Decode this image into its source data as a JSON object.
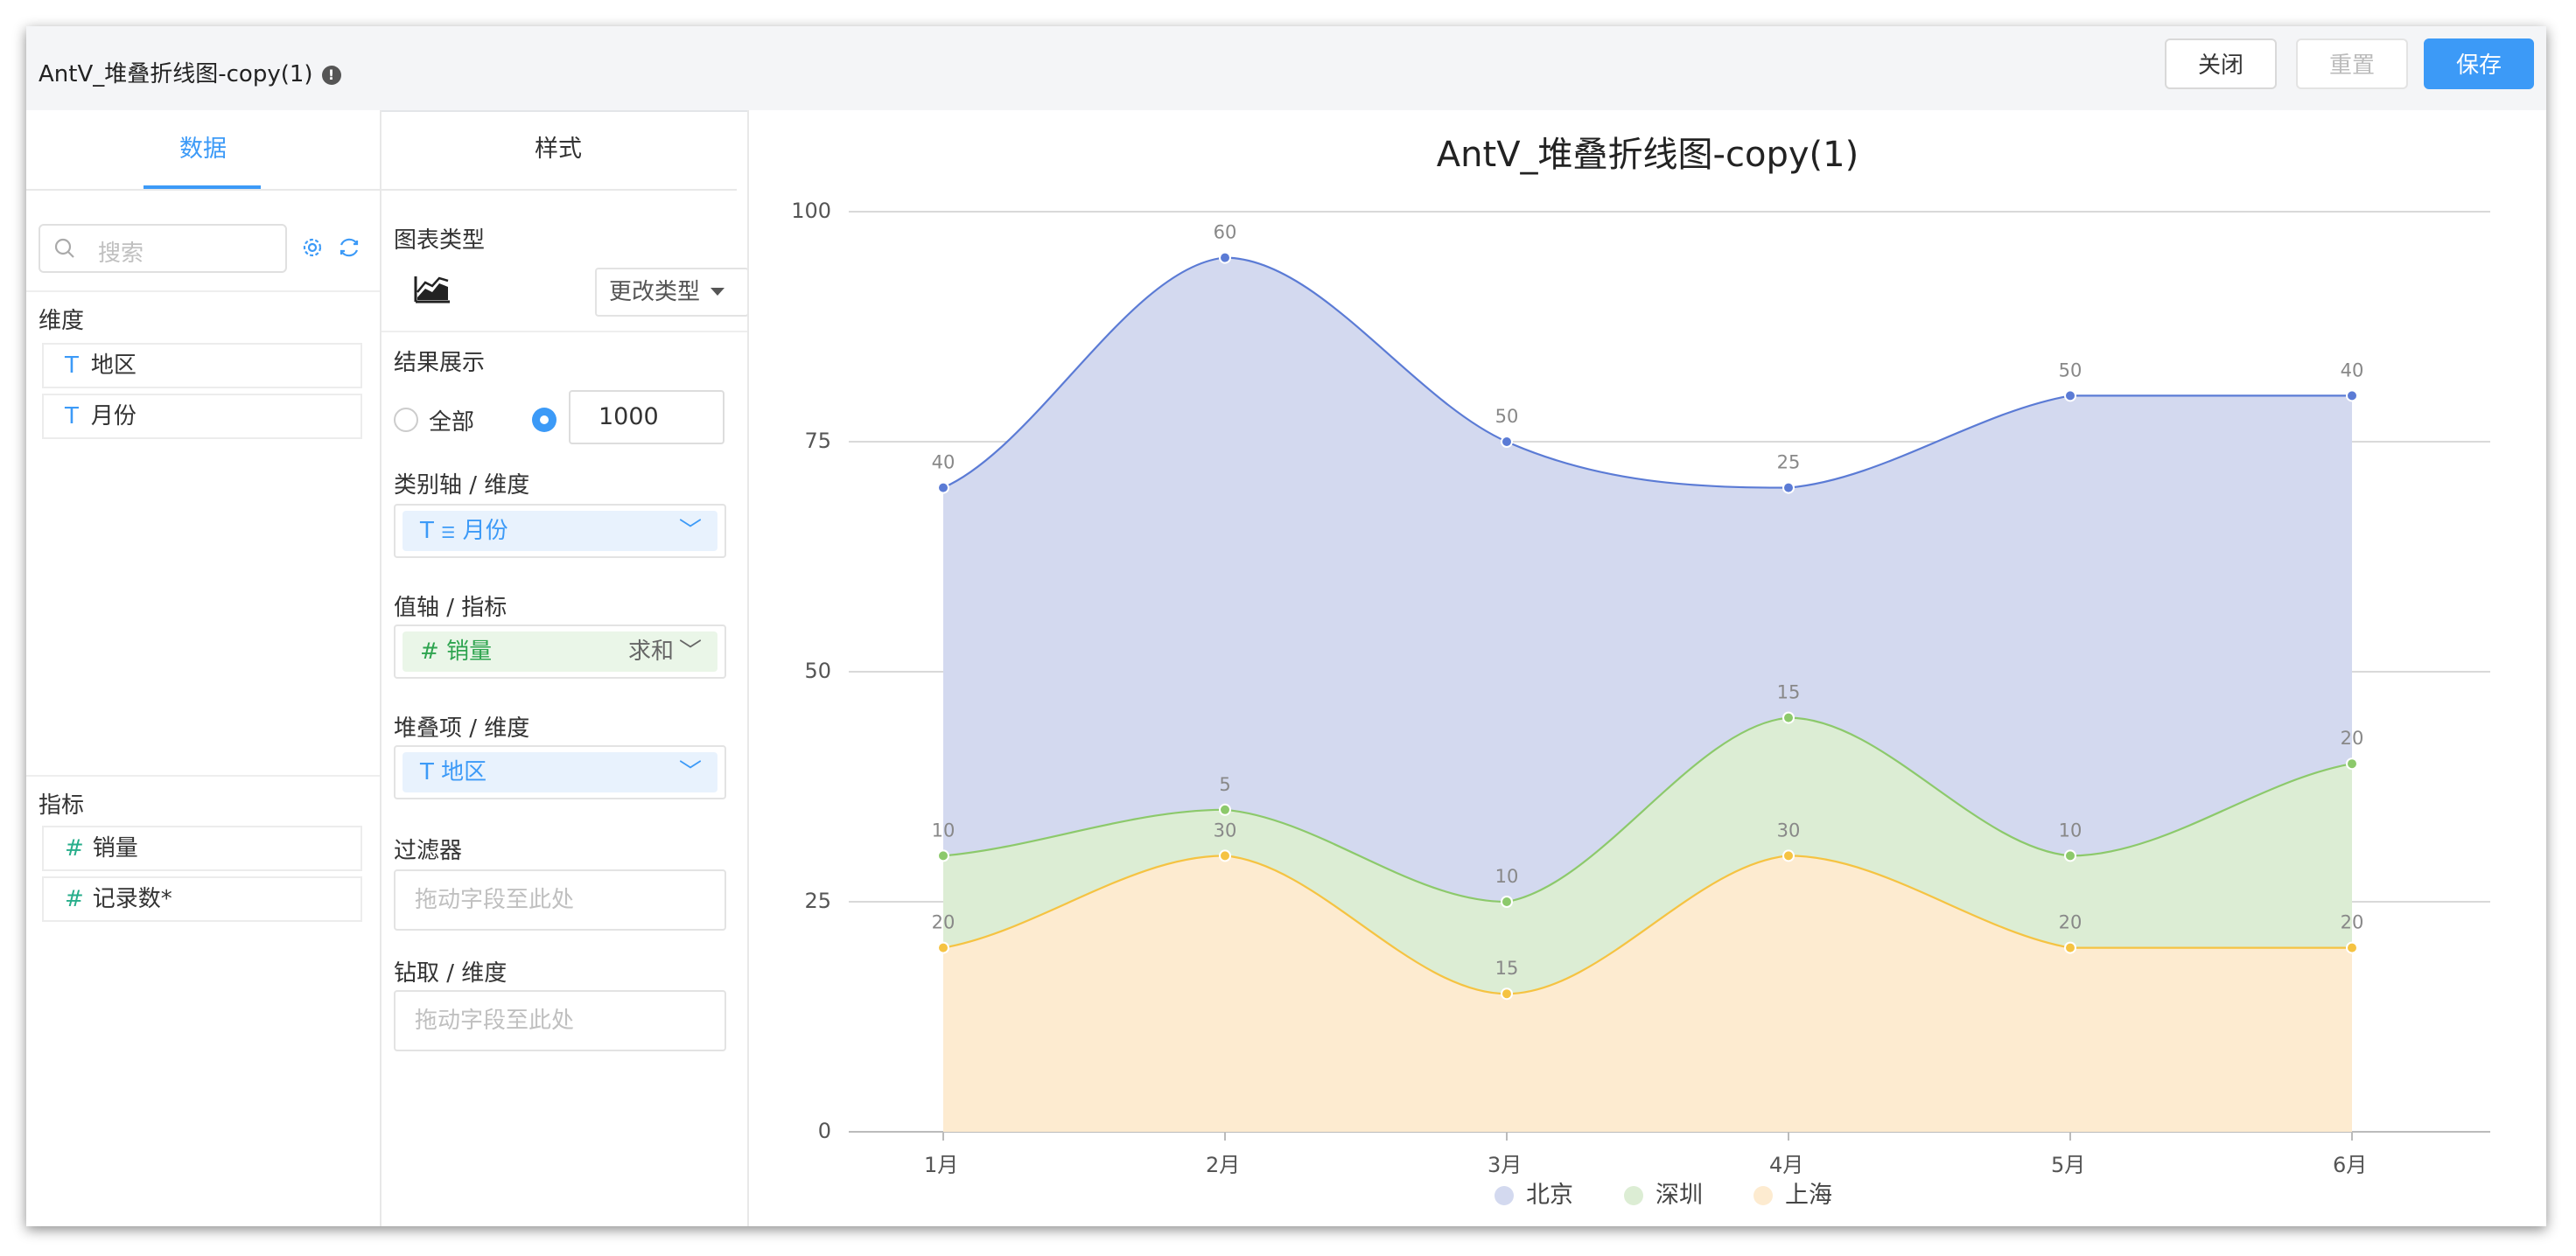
{
  "window": {
    "title": "AntV_堆叠折线图-copy(1)"
  },
  "header": {
    "close_label": "关闭",
    "reset_label": "重置",
    "save_label": "保存"
  },
  "tabs": {
    "data": "数据",
    "style": "样式"
  },
  "search": {
    "placeholder": "搜索"
  },
  "dimensions": {
    "label": "维度",
    "items": [
      "地区",
      "月份"
    ]
  },
  "measures": {
    "label": "指标",
    "items": [
      "销量",
      "记录数*"
    ]
  },
  "config": {
    "chart_type_label": "图表类型",
    "change_type_label": "更改类型",
    "result_label": "结果展示",
    "all_label": "全部",
    "limit_value": "1000",
    "category_axis_label": "类别轴 / 维度",
    "category_field": "月份",
    "value_axis_label": "值轴 / 指标",
    "value_field": "销量",
    "value_agg": "求和",
    "stack_label": "堆叠项 / 维度",
    "stack_field": "地区",
    "filter_label": "过滤器",
    "filter_placeholder": "拖动字段至此处",
    "drill_label": "钻取 / 维度",
    "drill_placeholder": "拖动字段至此处"
  },
  "chart_data": {
    "type": "area",
    "stacked": true,
    "smooth": true,
    "title": "AntV_堆叠折线图-copy(1)",
    "categories": [
      "1月",
      "2月",
      "3月",
      "4月",
      "5月",
      "6月"
    ],
    "ylim": [
      0,
      100
    ],
    "yticks": [
      0,
      25,
      50,
      75,
      100
    ],
    "grid": true,
    "legend_position": "bottom",
    "series": [
      {
        "name": "上海",
        "values": [
          20,
          30,
          15,
          30,
          20,
          20
        ],
        "color": "#f5c342"
      },
      {
        "name": "深圳",
        "values": [
          10,
          5,
          10,
          15,
          10,
          20
        ],
        "color": "#8cc96b"
      },
      {
        "name": "北京",
        "values": [
          40,
          60,
          50,
          25,
          50,
          40
        ],
        "color": "#5b7bd5"
      }
    ]
  },
  "colors": {
    "accent": "#3c9af7",
    "fill_bj": "#d3d9ef",
    "fill_sz": "#dcedd4",
    "fill_sh": "#fdebd0"
  }
}
